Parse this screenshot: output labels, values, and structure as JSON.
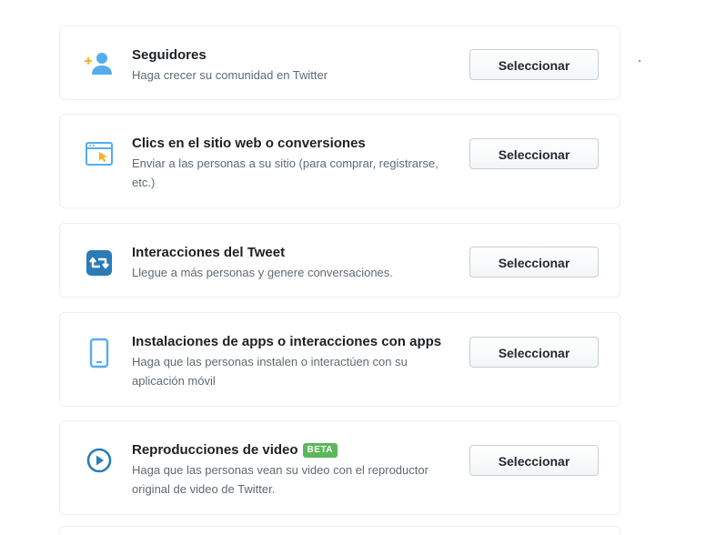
{
  "objectives": [
    {
      "title": "Seguidores",
      "description": "Haga crecer su comunidad en Twitter",
      "button_label": "Seleccionar",
      "icon": "add-follower-icon"
    },
    {
      "title": "Clics en el sitio web o conversiones",
      "description": "Enviar a las personas a su sitio (para comprar, registrarse, etc.)",
      "button_label": "Seleccionar",
      "icon": "browser-click-icon"
    },
    {
      "title": "Interacciones del Tweet",
      "description": "Llegue a más personas y genere conversaciones.",
      "button_label": "Seleccionar",
      "icon": "retweet-icon"
    },
    {
      "title": "Instalaciones de apps o interacciones con apps",
      "description": "Haga que las personas instalen o interactúen con su aplicación móvil",
      "button_label": "Seleccionar",
      "icon": "mobile-phone-icon"
    },
    {
      "title": "Reproducciones de video",
      "badge": "BETA",
      "description": "Haga que las personas vean su video con el reproductor original de video de Twitter.",
      "button_label": "Seleccionar",
      "icon": "play-icon"
    }
  ],
  "colors": {
    "icon_blue": "#2b7bb9",
    "icon_light_blue": "#55acee",
    "icon_yellow": "#ffad1f",
    "beta_green": "#5bb75b"
  }
}
